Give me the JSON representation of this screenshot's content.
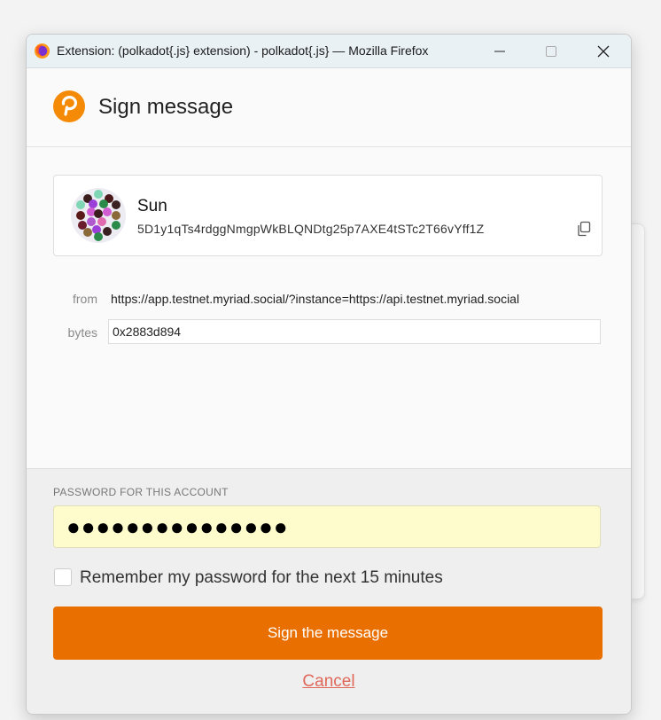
{
  "window": {
    "title": "Extension: (polkadot{.js} extension) - polkadot{.js} — Mozilla Firefox"
  },
  "header": {
    "title": "Sign message"
  },
  "account": {
    "name": "Sun",
    "address": "5D1y1qTs4rdggNmgpWkBLQNDtg25p7AXE4tSTc2T66vYff1Z"
  },
  "request": {
    "from_label": "from",
    "from_value": "https://app.testnet.myriad.social/?instance=https://api.testnet.myriad.social",
    "bytes_label": "bytes",
    "bytes_value": "0x2883d894"
  },
  "password": {
    "label": "PASSWORD FOR THIS ACCOUNT",
    "masked_value": "●●●●●●●●●●●●●●●",
    "remember_label": "Remember my password for the next 15 minutes",
    "remember_checked": false
  },
  "actions": {
    "sign_label": "Sign the message",
    "cancel_label": "Cancel"
  },
  "colors": {
    "accent": "#e86f00",
    "cancel": "#e0685a",
    "password_bg": "#fefbcc"
  },
  "identicon_colors": [
    "#7ed6b4",
    "#3b1d1d",
    "#4a1a1a",
    "#d15cd1",
    "#9b3fd8",
    "#2a8a4a",
    "#8b6a3a",
    "#e06bb0",
    "#b05acd",
    "#6a1d2a",
    "#5a1a1a",
    "#3a2020"
  ]
}
